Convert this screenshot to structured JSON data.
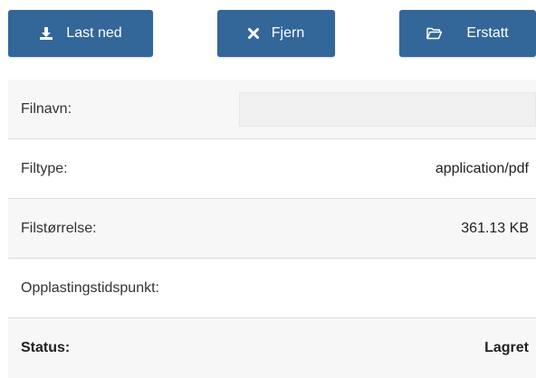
{
  "toolbar": {
    "download_label": "Last ned",
    "remove_label": "Fjern",
    "replace_label": "Erstatt",
    "download_icon": "download-icon",
    "remove_icon": "close-icon",
    "replace_icon": "folder-open-icon",
    "button_color": "#336699"
  },
  "details": {
    "filename_label": "Filnavn:",
    "filename_value": "",
    "filetype_label": "Filtype:",
    "filetype_value": "application/pdf",
    "filesize_label": "Filstørrelse:",
    "filesize_value": "361.13 KB",
    "uploaded_label": "Opplastingstidspunkt:",
    "uploaded_value": "",
    "status_label": "Status:",
    "status_value": "Lagret"
  }
}
